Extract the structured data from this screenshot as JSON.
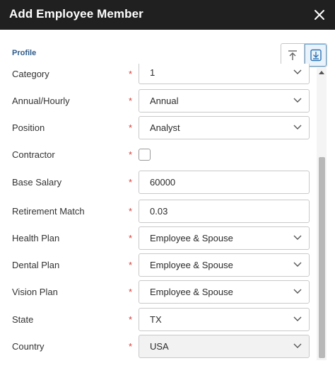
{
  "dialog": {
    "title": "Add Employee Member",
    "close_icon": "close-icon"
  },
  "section": {
    "label": "Profile"
  },
  "toolbar": {
    "icons": [
      "collapse-up-icon",
      "expand-down-icon"
    ]
  },
  "fields": [
    {
      "label": "Category",
      "required": "*",
      "value": "1",
      "type": "select"
    },
    {
      "label": "Annual/Hourly",
      "required": "*",
      "value": "Annual",
      "type": "select"
    },
    {
      "label": "Position",
      "required": "*",
      "value": "Analyst",
      "type": "select"
    },
    {
      "label": "Contractor",
      "required": "*",
      "value": "",
      "type": "checkbox"
    },
    {
      "label": "Base Salary",
      "required": "*",
      "value": "60000",
      "type": "text"
    },
    {
      "label": "Retirement Match",
      "required": "*",
      "value": "0.03",
      "type": "text"
    },
    {
      "label": "Health Plan",
      "required": "*",
      "value": "Employee & Spouse",
      "type": "select"
    },
    {
      "label": "Dental Plan",
      "required": "*",
      "value": "Employee & Spouse",
      "type": "select"
    },
    {
      "label": "Vision Plan",
      "required": "*",
      "value": "Employee & Spouse",
      "type": "select"
    },
    {
      "label": "State",
      "required": "*",
      "value": "TX",
      "type": "select"
    },
    {
      "label": "Country",
      "required": "*",
      "value": "USA",
      "type": "select"
    }
  ]
}
